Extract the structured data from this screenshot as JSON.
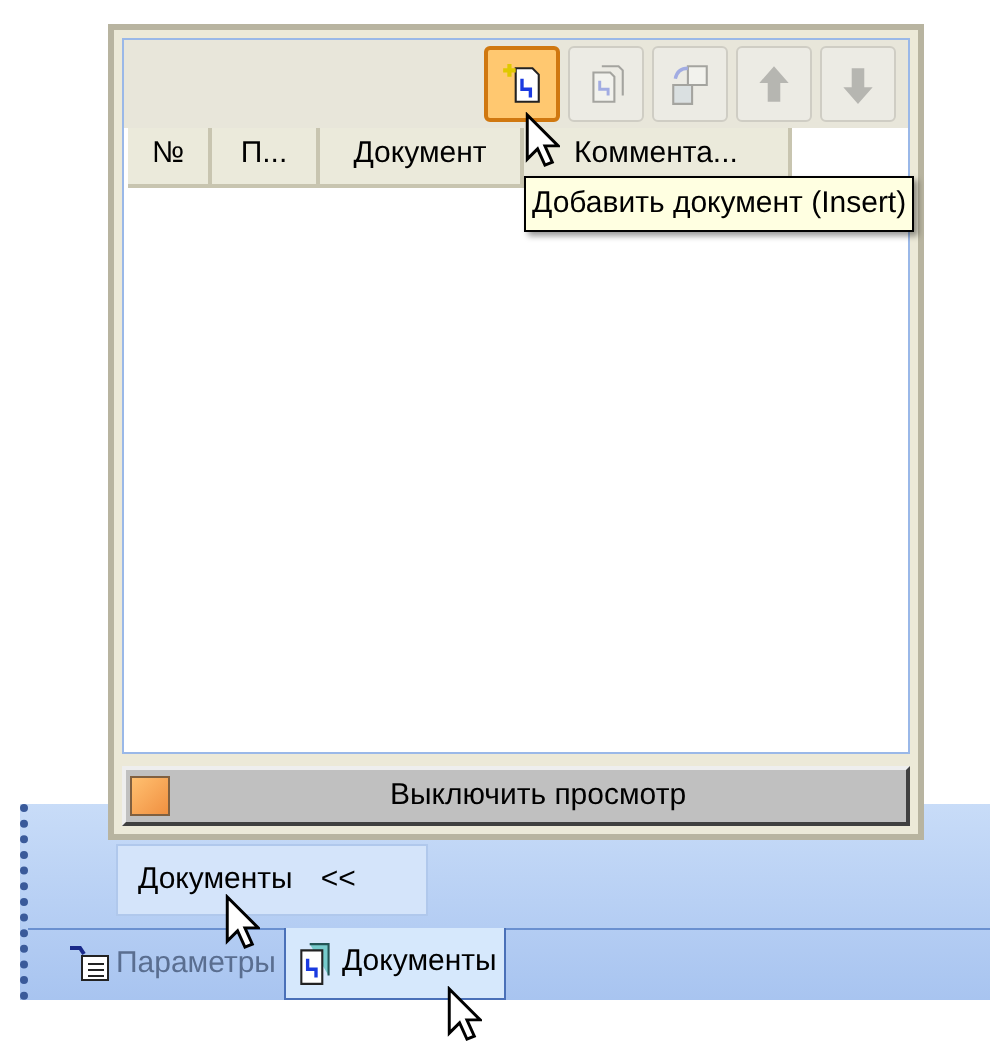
{
  "panel": {
    "toolbar": [
      {
        "kind": "add",
        "hovered": true,
        "disabled": false
      },
      {
        "kind": "copy",
        "hovered": false,
        "disabled": true
      },
      {
        "kind": "replace",
        "hovered": false,
        "disabled": true
      },
      {
        "kind": "up",
        "hovered": false,
        "disabled": true
      },
      {
        "kind": "down",
        "hovered": false,
        "disabled": true
      }
    ],
    "table": {
      "columns": [
        "№",
        "П...",
        "Документ",
        "Коммента..."
      ]
    },
    "tooltip": "Добавить документ (Insert)",
    "preview_button": "Выключить просмотр"
  },
  "toolbar_button": {
    "label": "Документы",
    "chevron": "<<"
  },
  "tabs": [
    {
      "label": "Параметры",
      "selected": false
    },
    {
      "label": "Документы",
      "selected": true
    }
  ]
}
